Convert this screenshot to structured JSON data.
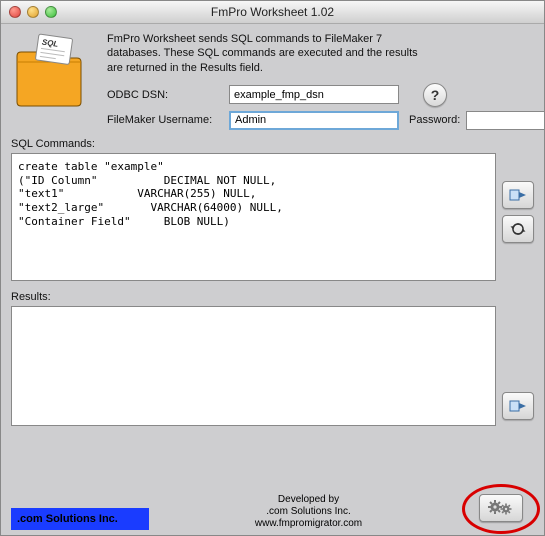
{
  "window": {
    "title": "FmPro Worksheet 1.02"
  },
  "description": "FmPro Worksheet sends SQL commands to FileMaker 7 databases. These SQL commands are executed and the results are returned in the Results field.",
  "fields": {
    "odbc_label": "ODBC DSN:",
    "odbc_value": "example_fmp_dsn",
    "username_label": "FileMaker Username:",
    "username_value": "Admin",
    "password_label": "Password:",
    "password_value": ""
  },
  "help_symbol": "?",
  "sections": {
    "sql_label": "SQL Commands:",
    "results_label": "Results:"
  },
  "sql_text": "create table \"example\"\n(\"ID Column\"          DECIMAL NOT NULL,\n\"text1\"           VARCHAR(255) NULL,\n\"text2_large\"       VARCHAR(64000) NULL,\n\"Container Field\"     BLOB NULL)",
  "results_text": "",
  "footer": {
    "logo": ".com Solutions Inc.",
    "credit_line1": "Developed by",
    "credit_line2": ".com Solutions Inc.",
    "credit_line3": "www.fmpromigrator.com"
  }
}
